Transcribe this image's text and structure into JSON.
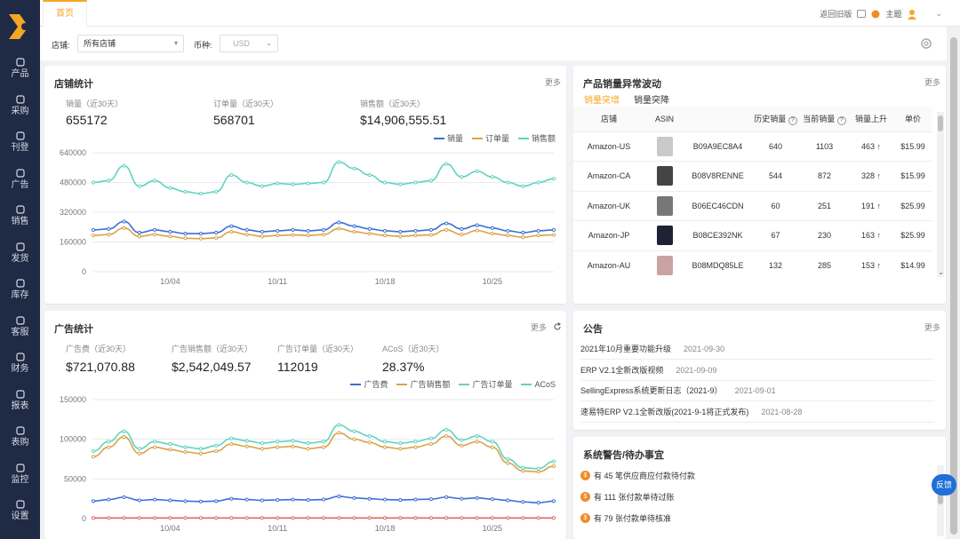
{
  "app": {
    "nav": [
      {
        "id": "product",
        "label": "产品"
      },
      {
        "id": "purchase",
        "label": "采购"
      },
      {
        "id": "listing",
        "label": "刊登"
      },
      {
        "id": "ads",
        "label": "广告"
      },
      {
        "id": "sales",
        "label": "销售"
      },
      {
        "id": "shipping",
        "label": "发货"
      },
      {
        "id": "inventory",
        "label": "库存"
      },
      {
        "id": "customer",
        "label": "客服"
      },
      {
        "id": "finance",
        "label": "财务"
      },
      {
        "id": "reports",
        "label": "报表"
      },
      {
        "id": "subscribe",
        "label": "表购"
      },
      {
        "id": "monitor",
        "label": "监控"
      },
      {
        "id": "settings",
        "label": "设置"
      }
    ]
  },
  "topbar": {
    "tab_home": "首页",
    "return_old": "返回旧版",
    "theme": "主题"
  },
  "filters": {
    "store_label": "店铺:",
    "store_value": "所有店铺",
    "currency_label": "币种:",
    "currency_value": "USD"
  },
  "store_stats": {
    "title": "店铺统计",
    "more": "更多",
    "kpis": [
      {
        "label": "销量（近30天）",
        "value": "655172"
      },
      {
        "label": "订单量（近30天）",
        "value": "568701"
      },
      {
        "label": "销售额（近30天）",
        "value": "$14,906,555.51"
      }
    ],
    "legend": [
      "销量",
      "订单量",
      "销售额"
    ]
  },
  "ad_stats": {
    "title": "广告统计",
    "more": "更多",
    "kpis": [
      {
        "label": "广告费（近30天）",
        "value": "$721,070.88"
      },
      {
        "label": "广告销售额（近30天）",
        "value": "$2,542,049.57"
      },
      {
        "label": "广告订单量（近30天）",
        "value": "112019"
      },
      {
        "label": "ACoS（近30天）",
        "value": "28.37%"
      }
    ],
    "legend": [
      "广告费",
      "广告销售额",
      "广告订单量",
      "ACoS"
    ]
  },
  "chart_data": [
    {
      "type": "line",
      "xlabel": "",
      "ylabel": "",
      "ylim": [
        0,
        640000
      ],
      "yticks": [
        0,
        160000,
        320000,
        480000,
        640000
      ],
      "x": [
        "09/29",
        "09/30",
        "10/01",
        "10/02",
        "10/03",
        "10/04",
        "10/05",
        "10/06",
        "10/07",
        "10/08",
        "10/09",
        "10/10",
        "10/11",
        "10/12",
        "10/13",
        "10/14",
        "10/15",
        "10/16",
        "10/17",
        "10/18",
        "10/19",
        "10/20",
        "10/21",
        "10/22",
        "10/23",
        "10/24",
        "10/25",
        "10/26",
        "10/27",
        "10/28",
        "10/29"
      ],
      "xtick_labels": [
        "10/04",
        "10/11",
        "10/18",
        "10/25"
      ],
      "grid": true,
      "legend_position": "top-right",
      "series": [
        {
          "name": "销量",
          "color": "#3b6fd6",
          "values": [
            225000,
            230000,
            270000,
            210000,
            225000,
            215000,
            205000,
            205000,
            210000,
            245000,
            225000,
            215000,
            220000,
            225000,
            220000,
            225000,
            265000,
            245000,
            230000,
            220000,
            215000,
            220000,
            225000,
            260000,
            230000,
            250000,
            235000,
            220000,
            210000,
            220000,
            225000
          ]
        },
        {
          "name": "订单量",
          "color": "#d9a24a",
          "values": [
            195000,
            200000,
            235000,
            190000,
            200000,
            190000,
            180000,
            178000,
            182000,
            215000,
            200000,
            190000,
            195000,
            198000,
            195000,
            200000,
            232000,
            215000,
            205000,
            195000,
            190000,
            195000,
            198000,
            225000,
            200000,
            222000,
            205000,
            195000,
            185000,
            195000,
            198000
          ]
        },
        {
          "name": "销售额",
          "color": "#5fd3c0",
          "values": [
            480000,
            490000,
            570000,
            460000,
            490000,
            450000,
            430000,
            420000,
            430000,
            520000,
            480000,
            460000,
            475000,
            470000,
            475000,
            480000,
            590000,
            555000,
            520000,
            480000,
            470000,
            480000,
            490000,
            580000,
            510000,
            540000,
            510000,
            480000,
            460000,
            480000,
            500000
          ]
        }
      ]
    },
    {
      "type": "line",
      "xlabel": "",
      "ylabel": "",
      "ylim": [
        0,
        150000
      ],
      "yticks": [
        0,
        50000,
        100000,
        150000
      ],
      "x": [
        "09/29",
        "09/30",
        "10/01",
        "10/02",
        "10/03",
        "10/04",
        "10/05",
        "10/06",
        "10/07",
        "10/08",
        "10/09",
        "10/10",
        "10/11",
        "10/12",
        "10/13",
        "10/14",
        "10/15",
        "10/16",
        "10/17",
        "10/18",
        "10/19",
        "10/20",
        "10/21",
        "10/22",
        "10/23",
        "10/24",
        "10/25",
        "10/26",
        "10/27",
        "10/28",
        "10/29"
      ],
      "xtick_labels": [
        "10/04",
        "10/11",
        "10/18",
        "10/25"
      ],
      "grid": true,
      "legend_position": "top-right",
      "series": [
        {
          "name": "广告费",
          "color": "#3b6fd6",
          "values": [
            22000,
            24000,
            27000,
            23000,
            24000,
            23000,
            22000,
            21500,
            22000,
            25000,
            24000,
            23000,
            23500,
            24000,
            23500,
            24000,
            28000,
            26000,
            25000,
            24000,
            23500,
            24000,
            24500,
            27000,
            25000,
            26000,
            24500,
            23000,
            21000,
            20000,
            22000
          ]
        },
        {
          "name": "广告销售额",
          "color": "#d9a24a",
          "values": [
            78000,
            90000,
            103000,
            82000,
            90000,
            87000,
            84000,
            82000,
            85000,
            94000,
            91000,
            88000,
            90000,
            91000,
            88000,
            90000,
            108000,
            100000,
            96000,
            90000,
            88000,
            90000,
            94000,
            104000,
            92000,
            97000,
            90000,
            70000,
            60000,
            59000,
            66000
          ]
        },
        {
          "name": "广告订单量",
          "color": "#5fd3c0",
          "values": [
            85000,
            97000,
            110000,
            88000,
            97000,
            94000,
            90000,
            88000,
            92000,
            101000,
            98000,
            95000,
            97000,
            98000,
            95000,
            97000,
            118000,
            110000,
            104000,
            97000,
            95000,
            97000,
            101000,
            112000,
            99000,
            104000,
            97000,
            75000,
            64000,
            63000,
            72000
          ]
        },
        {
          "name": "ACoS",
          "color": "#e26b6b",
          "values": [
            800,
            800,
            800,
            800,
            800,
            800,
            800,
            800,
            800,
            800,
            800,
            800,
            800,
            800,
            800,
            800,
            800,
            800,
            800,
            800,
            800,
            800,
            800,
            800,
            800,
            800,
            800,
            800,
            800,
            800,
            800
          ]
        }
      ]
    }
  ],
  "anomaly": {
    "title": "产品销量异常波动",
    "more": "更多",
    "tabs": [
      "销量突增",
      "销量突降"
    ],
    "headers": [
      "店铺",
      "ASIN",
      "历史销量",
      "当前销量",
      "销量上升",
      "单价"
    ],
    "rows": [
      {
        "store": "Amazon-US",
        "asin": "B09A9EC8A4",
        "hist": "640",
        "cur": "1103",
        "rise": "463 ↑",
        "price": "$15.99",
        "thumb": "#c9c9c9"
      },
      {
        "store": "Amazon-CA",
        "asin": "B08V8RENNE",
        "hist": "544",
        "cur": "872",
        "rise": "328 ↑",
        "price": "$15.99",
        "thumb": "#444444"
      },
      {
        "store": "Amazon-UK",
        "asin": "B06EC46CDN",
        "hist": "60",
        "cur": "251",
        "rise": "191 ↑",
        "price": "$25.99",
        "thumb": "#777777"
      },
      {
        "store": "Amazon-JP",
        "asin": "B08CE392NK",
        "hist": "67",
        "cur": "230",
        "rise": "163 ↑",
        "price": "$25.99",
        "thumb": "#1e2233"
      },
      {
        "store": "Amazon-AU",
        "asin": "B08MDQ85LE",
        "hist": "132",
        "cur": "285",
        "rise": "153 ↑",
        "price": "$14.99",
        "thumb": "#c9a3a3"
      }
    ]
  },
  "notices": {
    "title": "公告",
    "more": "更多",
    "items": [
      {
        "text": "2021年10月重要功能升级",
        "date": "2021-09-30"
      },
      {
        "text": "ERP V2.1全新改版视频",
        "date": "2021-09-09"
      },
      {
        "text": "SellingExpress系统更新日志（2021-9）",
        "date": "2021-09-01"
      },
      {
        "text": "速易特ERP V2.1全新改版(2021-9-1将正式发布)",
        "date": "2021-08-28"
      }
    ]
  },
  "todo": {
    "title": "系统警告/待办事宜",
    "items": [
      {
        "text": "有 45 笔供应商应付款待付款"
      },
      {
        "text": "有 111 张付款单待过账"
      },
      {
        "text": "有 79 张付款单待核准"
      }
    ]
  },
  "feedback": "反馈"
}
